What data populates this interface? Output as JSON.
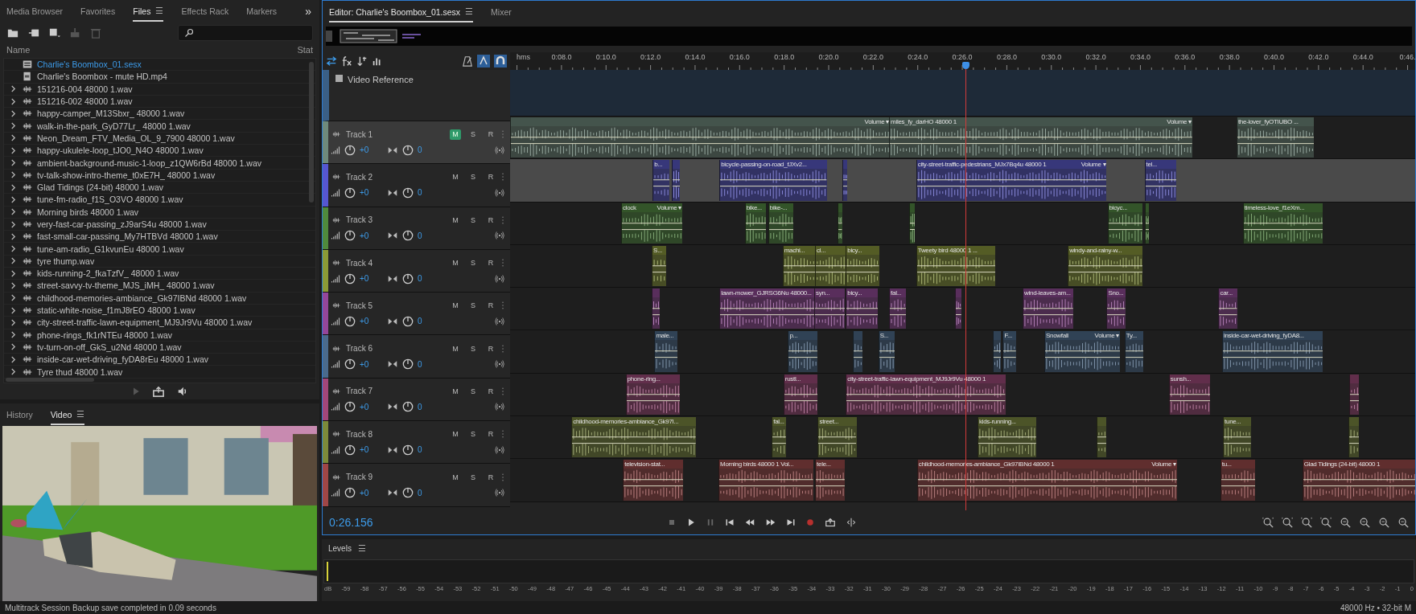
{
  "left_panel": {
    "tabs": [
      {
        "label": "Media Browser",
        "selected": false
      },
      {
        "label": "Favorites",
        "selected": false
      },
      {
        "label": "Files",
        "selected": true,
        "menu": "☰"
      },
      {
        "label": "Effects Rack",
        "selected": false
      },
      {
        "label": "Markers",
        "selected": false
      }
    ],
    "overflow": "»",
    "columns": [
      "Name",
      "Stat"
    ],
    "files": [
      {
        "name": "Charlie's Boombox_01.sesx",
        "kind": "session"
      },
      {
        "name": "Charlie's Boombox - mute HD.mp4",
        "kind": "video"
      },
      {
        "name": "151216-004 48000 1.wav",
        "kind": "audio"
      },
      {
        "name": "151216-002 48000 1.wav",
        "kind": "audio"
      },
      {
        "name": "happy-camper_M13Sbxr_ 48000 1.wav",
        "kind": "audio"
      },
      {
        "name": "walk-in-the-park_GyD77Lr_ 48000 1.wav",
        "kind": "audio"
      },
      {
        "name": "Neon_Dream_FTV_Media_OL_9_7900 48000 1.wav",
        "kind": "audio"
      },
      {
        "name": "happy-ukulele-loop_tJO0_N4O 48000 1.wav",
        "kind": "audio"
      },
      {
        "name": "ambient-background-music-1-loop_z1QW6rBd 48000 1.wav",
        "kind": "audio"
      },
      {
        "name": "tv-talk-show-intro-theme_t0xE7H_ 48000 1.wav",
        "kind": "audio"
      },
      {
        "name": "Glad Tidings (24-bit) 48000 1.wav",
        "kind": "audio"
      },
      {
        "name": "tune-fm-radio_f1S_O3VO 48000 1.wav",
        "kind": "audio"
      },
      {
        "name": "Morning birds 48000 1.wav",
        "kind": "audio"
      },
      {
        "name": "very-fast-car-passing_zJ9arS4u 48000 1.wav",
        "kind": "audio"
      },
      {
        "name": "fast-small-car-passing_My7HTBVd 48000 1.wav",
        "kind": "audio"
      },
      {
        "name": "tune-am-radio_G1kvunEu 48000 1.wav",
        "kind": "audio"
      },
      {
        "name": "tyre thump.wav",
        "kind": "audio"
      },
      {
        "name": "kids-running-2_fkaTzfV_ 48000 1.wav",
        "kind": "audio"
      },
      {
        "name": "street-savvy-tv-theme_MJS_iMH_ 48000 1.wav",
        "kind": "audio"
      },
      {
        "name": "childhood-memories-ambiance_Gk97IBNd 48000 1.wav",
        "kind": "audio"
      },
      {
        "name": "static-white-noise_f1mJ8rEO 48000 1.wav",
        "kind": "audio"
      },
      {
        "name": "city-street-traffic-lawn-equipment_MJ9Jr9Vu 48000 1.wav",
        "kind": "audio"
      },
      {
        "name": "phone-rings_fk1rNTEu 48000 1.wav",
        "kind": "audio"
      },
      {
        "name": "tv-turn-on-off_GkS_u2Nd 48000 1.wav",
        "kind": "audio"
      },
      {
        "name": "inside-car-wet-driving_fyDA8rEu 48000 1.wav",
        "kind": "audio"
      },
      {
        "name": "Tyre thud 48000 1.wav",
        "kind": "audio"
      }
    ]
  },
  "lower_panel": {
    "tabs": [
      {
        "label": "History",
        "selected": false
      },
      {
        "label": "Video",
        "selected": true,
        "menu": "☰"
      }
    ]
  },
  "editor": {
    "tabs": [
      {
        "label": "Editor: Charlie's Boombox_01.sesx",
        "selected": true,
        "menu": "☰"
      },
      {
        "label": "Mixer",
        "selected": false
      }
    ],
    "ruler": [
      "hms",
      "0:08.0",
      "0:10.0",
      "0:12.0",
      "0:14.0",
      "0:16.0",
      "0:18.0",
      "0:20.0",
      "0:22.0",
      "0:24.0",
      "0:26.0",
      "0:28.0",
      "0:30.0",
      "0:32.0",
      "0:34.0",
      "0:36.0",
      "0:38.0",
      "0:40.0",
      "0:42.0",
      "0:44.0",
      "0:46."
    ],
    "video_reference": "Video Reference",
    "tracks": [
      {
        "name": "Track 1",
        "color": "#6e8a7c",
        "selected": true,
        "range_selected": false,
        "buttons": [
          {
            "label": "M",
            "on": true
          },
          {
            "label": "S",
            "on": false
          },
          {
            "label": "R",
            "on": false
          }
        ],
        "volume": "+0",
        "pan": "0",
        "clips": [
          {
            "kind": "audio",
            "menu": "Volume ▾"
          },
          {
            "kind": "audio",
            "title": "miles_fy_darHO 48000 1",
            "menu": "Volume ▾"
          },
          {
            "kind": "audio",
            "title": "the-lover_fyOTIUBO ..."
          }
        ]
      },
      {
        "name": "Track 2",
        "color": "#5656d0",
        "selected": false,
        "range_selected": true,
        "buttons": [
          {
            "label": "M",
            "on": false
          },
          {
            "label": "S",
            "on": false
          },
          {
            "label": "R",
            "on": false
          }
        ],
        "volume": "+0",
        "pan": "0",
        "clips": [
          {
            "kind": "audio",
            "title": "b..."
          },
          {
            "kind": "audio"
          },
          {
            "kind": "audio",
            "title": "bicycle-passing-on-road_fJXv2..."
          },
          {
            "kind": "audio"
          },
          {
            "kind": "audio",
            "title": "city-street-traffic-pedestrians_MJx7Bq4u 48000 1",
            "menu": "Volume ▾"
          },
          {
            "kind": "audio",
            "title": "tel..."
          }
        ]
      },
      {
        "name": "Track 3",
        "color": "#4f8a3c",
        "selected": false,
        "range_selected": false,
        "buttons": [
          {
            "label": "M",
            "on": false
          },
          {
            "label": "S",
            "on": false
          },
          {
            "label": "R",
            "on": false
          }
        ],
        "volume": "+0",
        "pan": "0",
        "clips": [
          {
            "kind": "audio",
            "title": "clock",
            "menu": "Volume ▾"
          },
          {
            "kind": "audio",
            "title": "bike..."
          },
          {
            "kind": "audio",
            "title": "bike-..."
          },
          {
            "kind": "audio"
          },
          {
            "kind": "audio"
          },
          {
            "kind": "audio",
            "title": "bicyc..."
          },
          {
            "kind": "audio"
          },
          {
            "kind": "audio",
            "title": "timeless-love_f1eXm..."
          }
        ]
      },
      {
        "name": "Track 4",
        "color": "#8a9a36",
        "selected": false,
        "range_selected": false,
        "buttons": [
          {
            "label": "M",
            "on": false
          },
          {
            "label": "S",
            "on": false
          },
          {
            "label": "R",
            "on": false
          }
        ],
        "volume": "+0",
        "pan": "0",
        "clips": [
          {
            "kind": "audio",
            "title": "S..."
          },
          {
            "kind": "audio",
            "title": "machi..."
          },
          {
            "kind": "audio",
            "title": "cl..."
          },
          {
            "kind": "audio",
            "title": "bicy..."
          },
          {
            "kind": "audio",
            "title": "Tweety bird 48000 1 ..."
          },
          {
            "kind": "audio",
            "title": "windy-and-rainy-w..."
          }
        ]
      },
      {
        "name": "Track 5",
        "color": "#94469a",
        "selected": false,
        "range_selected": false,
        "buttons": [
          {
            "label": "M",
            "on": false
          },
          {
            "label": "S",
            "on": false
          },
          {
            "label": "R",
            "on": false
          }
        ],
        "volume": "+0",
        "pan": "0",
        "clips": [
          {
            "kind": "audio"
          },
          {
            "kind": "audio",
            "title": "lawn-mower_GJRSG6Nu 48000..."
          },
          {
            "kind": "audio",
            "title": "syn..."
          },
          {
            "kind": "audio",
            "title": "bicy..."
          },
          {
            "kind": "audio",
            "title": "fal..."
          },
          {
            "kind": "audio"
          },
          {
            "kind": "audio",
            "title": "wind-leaves-am..."
          },
          {
            "kind": "audio",
            "title": "Sno..."
          },
          {
            "kind": "audio",
            "title": "car..."
          }
        ]
      },
      {
        "name": "Track 6",
        "color": "#4a6a8c",
        "selected": false,
        "range_selected": false,
        "buttons": [
          {
            "label": "M",
            "on": false
          },
          {
            "label": "S",
            "on": false
          },
          {
            "label": "R",
            "on": false
          }
        ],
        "volume": "+0",
        "pan": "0",
        "clips": [
          {
            "kind": "audio",
            "title": "male..."
          },
          {
            "kind": "audio",
            "title": "p..."
          },
          {
            "kind": "audio"
          },
          {
            "kind": "audio",
            "title": "S..."
          },
          {
            "kind": "audio"
          },
          {
            "kind": "audio",
            "title": "F..."
          },
          {
            "kind": "audio",
            "title": "Snowfall",
            "menu": "Volume ▾"
          },
          {
            "kind": "audio",
            "title": "Ty..."
          },
          {
            "kind": "audio",
            "title": "inside-car-wet-driving_fyDA8..."
          }
        ]
      },
      {
        "name": "Track 7",
        "color": "#a2467a",
        "selected": false,
        "range_selected": false,
        "buttons": [
          {
            "label": "M",
            "on": false
          },
          {
            "label": "S",
            "on": false
          },
          {
            "label": "R",
            "on": false
          }
        ],
        "volume": "+0",
        "pan": "0",
        "clips": [
          {
            "kind": "audio",
            "title": "phone-ring..."
          },
          {
            "kind": "audio",
            "title": "rustl..."
          },
          {
            "kind": "audio",
            "title": "city-street-traffic-lawn-equipment_MJ9Jr9Vu 48000 1"
          },
          {
            "kind": "audio",
            "title": "sunsh..."
          },
          {
            "kind": "audio"
          }
        ]
      },
      {
        "name": "Track 8",
        "color": "#7c8a3a",
        "selected": false,
        "range_selected": false,
        "buttons": [
          {
            "label": "M",
            "on": false
          },
          {
            "label": "S",
            "on": false
          },
          {
            "label": "R",
            "on": false
          }
        ],
        "volume": "+0",
        "pan": "0",
        "clips": [
          {
            "kind": "audio",
            "title": "childhood-memories-ambiance_Gk97I..."
          },
          {
            "kind": "audio",
            "title": "fal..."
          },
          {
            "kind": "audio",
            "title": "street..."
          },
          {
            "kind": "audio",
            "title": "kids-running..."
          },
          {
            "kind": "audio"
          },
          {
            "kind": "audio",
            "title": "tune..."
          },
          {
            "kind": "audio"
          }
        ]
      },
      {
        "name": "Track 9",
        "color": "#a04646",
        "selected": false,
        "range_selected": false,
        "buttons": [
          {
            "label": "M",
            "on": false
          },
          {
            "label": "S",
            "on": false
          },
          {
            "label": "R",
            "on": false
          }
        ],
        "volume": "+0",
        "pan": "0",
        "clips": [
          {
            "kind": "audio",
            "title": "television-stat..."
          },
          {
            "kind": "audio",
            "title": "Morning birds 48000 1 Vol..."
          },
          {
            "kind": "audio",
            "title": "tele..."
          },
          {
            "kind": "audio",
            "title": "childhood-memories-ambiance_Gk97IBNd 48000 1",
            "menu": "Volume ▾"
          },
          {
            "kind": "audio",
            "title": "tu..."
          },
          {
            "kind": "audio",
            "title": "Glad Tidings (24-bit) 48000 1"
          }
        ]
      }
    ],
    "time": "0:26.156"
  },
  "levels": {
    "title": "Levels",
    "menu": "☰",
    "scale": [
      "dB",
      "-59",
      "-58",
      "-57",
      "-56",
      "-55",
      "-54",
      "-53",
      "-52",
      "-51",
      "-50",
      "-49",
      "-48",
      "-47",
      "-46",
      "-45",
      "-44",
      "-43",
      "-42",
      "-41",
      "-40",
      "-39",
      "-38",
      "-37",
      "-36",
      "-35",
      "-34",
      "-33",
      "-32",
      "-31",
      "-30",
      "-29",
      "-28",
      "-27",
      "-26",
      "-25",
      "-24",
      "-23",
      "-22",
      "-21",
      "-20",
      "-19",
      "-18",
      "-17",
      "-16",
      "-15",
      "-14",
      "-13",
      "-12",
      "-11",
      "-10",
      "-9",
      "-8",
      "-7",
      "-6",
      "-5",
      "-4",
      "-3",
      "-2",
      "-1",
      "0"
    ]
  },
  "status_bar": {
    "message": "Multitrack Session Backup save completed in 0.09 seconds",
    "format": "48000 Hz • 32-bit M"
  }
}
